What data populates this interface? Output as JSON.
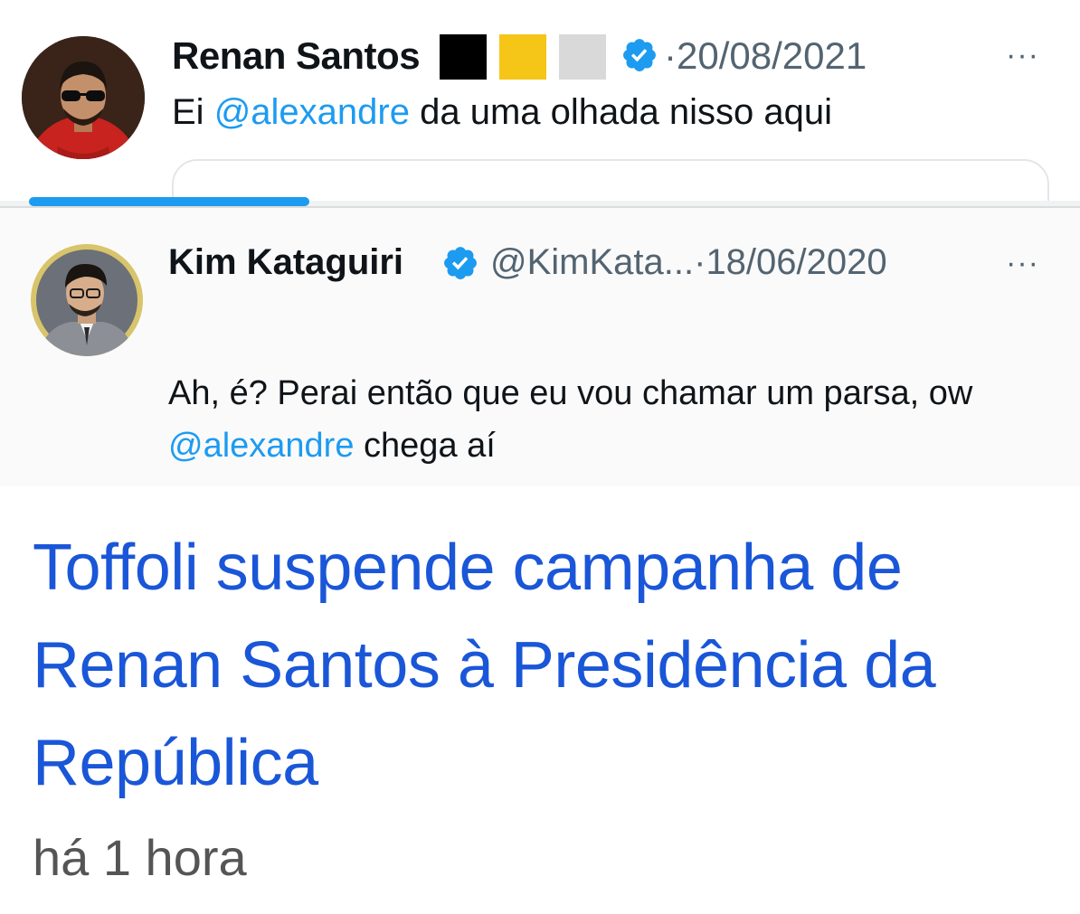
{
  "tweet1": {
    "author_name": "Renan Santos",
    "flag_colors": [
      "#000000",
      "#f5c518",
      "#d9d9d9"
    ],
    "verified_icon": "verified-badge-icon",
    "date": "·20/08/2021",
    "more_icon": "more-options-icon",
    "more_label": "···",
    "text_prefix": "Ei ",
    "mention": "@alexandre",
    "text_suffix": " da uma olhada nisso aqui",
    "video_progress": 0.26,
    "accent_color": "#1d9bf0"
  },
  "tweet2": {
    "author_name": "Kim Kataguiri",
    "verified_icon": "verified-badge-icon",
    "handle_date": "@KimKata...·18/06/2020",
    "more_icon": "more-options-icon",
    "more_label": "···",
    "text_prefix": "Ah, é? Perai então que eu vou chamar um parsa, ow ",
    "mention": "@alexandre",
    "text_suffix": " chega aí"
  },
  "news": {
    "headline": "Toffoli suspende campanha de Renan Santos à Presidência da República",
    "time_ago": "há 1 hora",
    "headline_color": "#1a56d8"
  }
}
